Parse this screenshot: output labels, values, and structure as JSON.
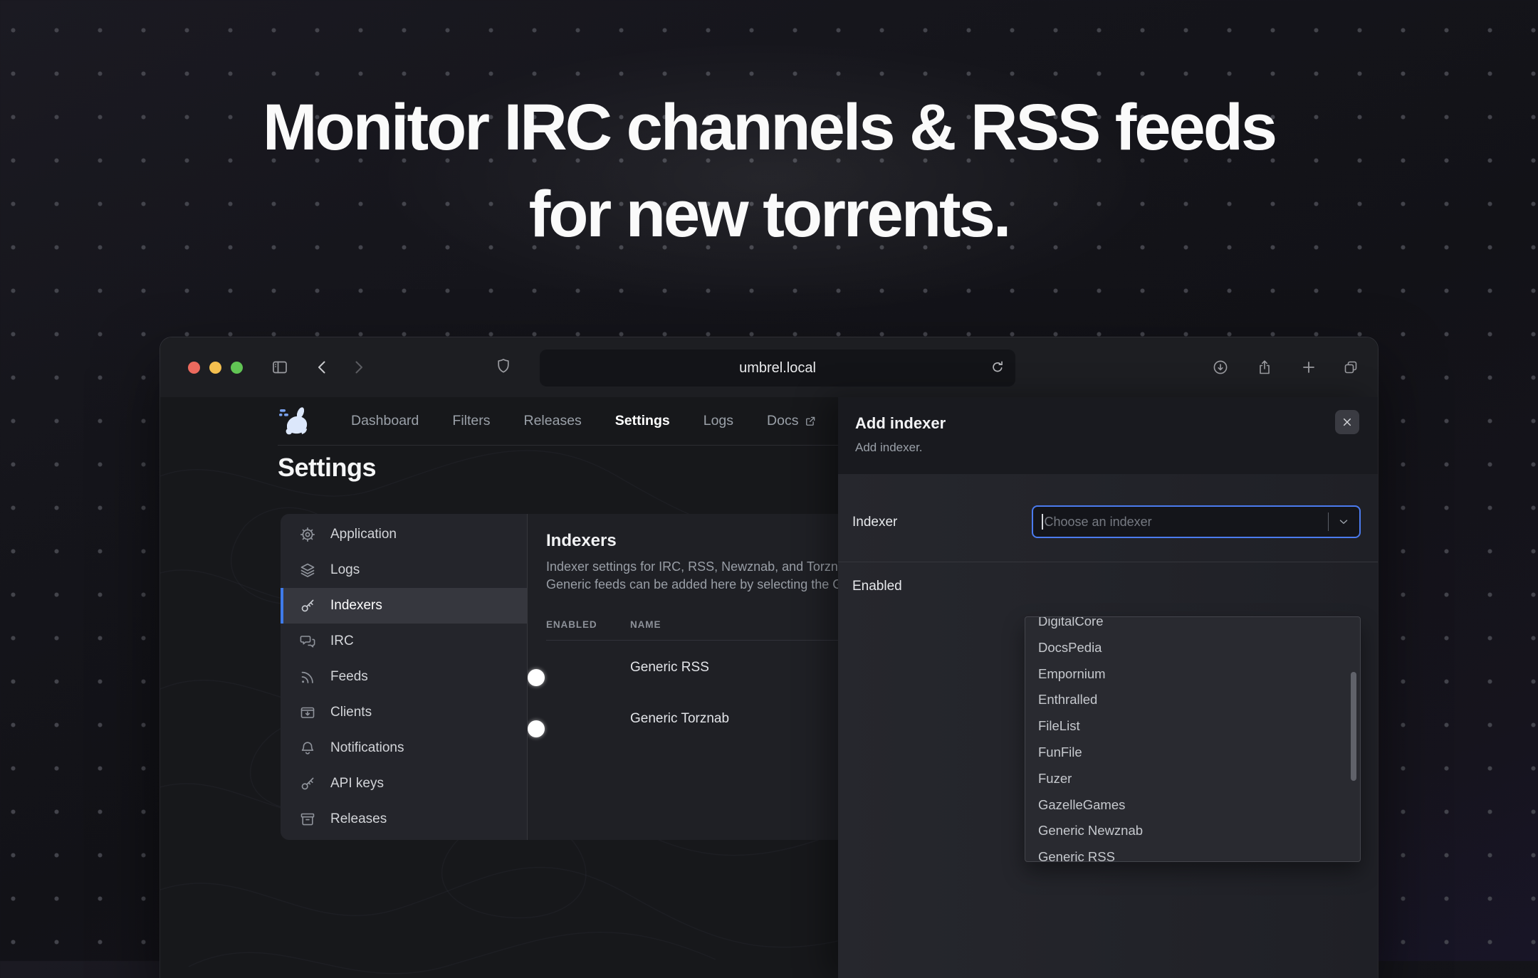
{
  "hero": {
    "title_line1": "Monitor IRC channels & RSS feeds",
    "title_line2": "for new torrents."
  },
  "browser": {
    "url": "umbrel.local",
    "traffic_lights": {
      "red": "#ec6a5e",
      "yellow": "#f4bf4f",
      "green": "#61c554"
    },
    "icons": [
      "sidebar-toggle-icon",
      "back-icon",
      "forward-icon",
      "shield-icon",
      "refresh-icon",
      "download-icon",
      "share-icon",
      "new-tab-icon",
      "tab-overview-icon"
    ]
  },
  "nav": {
    "logo": "autobrr-rabbit-logo",
    "items": [
      {
        "label": "Dashboard",
        "active": false
      },
      {
        "label": "Filters",
        "active": false
      },
      {
        "label": "Releases",
        "active": false
      },
      {
        "label": "Settings",
        "active": true
      },
      {
        "label": "Logs",
        "active": false
      },
      {
        "label": "Docs",
        "active": false,
        "icon": "external-link-icon"
      }
    ]
  },
  "settings": {
    "page_title": "Settings",
    "sidebar": [
      {
        "label": "Application",
        "icon": "gear-icon",
        "selected": false
      },
      {
        "label": "Logs",
        "icon": "stack-icon",
        "selected": false
      },
      {
        "label": "Indexers",
        "icon": "key-icon",
        "selected": true
      },
      {
        "label": "IRC",
        "icon": "chat-icon",
        "selected": false
      },
      {
        "label": "Feeds",
        "icon": "rss-icon",
        "selected": false
      },
      {
        "label": "Clients",
        "icon": "download-box-icon",
        "selected": false
      },
      {
        "label": "Notifications",
        "icon": "bell-icon",
        "selected": false
      },
      {
        "label": "API keys",
        "icon": "key-icon",
        "selected": false
      },
      {
        "label": "Releases",
        "icon": "archive-icon",
        "selected": false
      }
    ],
    "content": {
      "heading": "Indexers",
      "description_line1": "Indexer settings for IRC, RSS, Newznab, and Torznab b",
      "description_line2": "Generic feeds can be added here by selecting the Gene",
      "table": {
        "headers": [
          "ENABLED",
          "NAME"
        ],
        "rows": [
          {
            "enabled": true,
            "name": "Generic RSS"
          },
          {
            "enabled": true,
            "name": "Generic Torznab"
          }
        ]
      }
    }
  },
  "modal": {
    "title": "Add indexer",
    "subtitle": "Add indexer.",
    "fields": {
      "indexer_label": "Indexer",
      "indexer_placeholder": "Choose an indexer",
      "enabled_label": "Enabled"
    },
    "dropdown": {
      "items": [
        "DigitalCore",
        "DocsPedia",
        "Empornium",
        "Enthralled",
        "FileList",
        "FunFile",
        "Fuzer",
        "GazelleGames",
        "Generic Newznab",
        "Generic RSS"
      ]
    }
  },
  "colors": {
    "accent_blue": "#3f7bea",
    "toggle_on": "#3d7bf0",
    "input_focus_border": "#4b7bef"
  }
}
